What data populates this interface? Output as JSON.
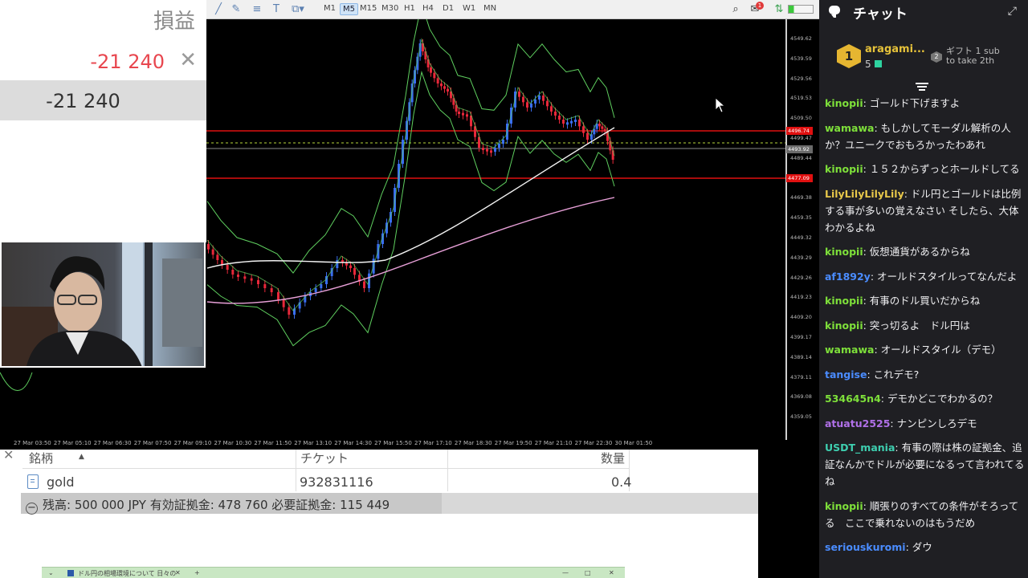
{
  "pl_panel": {
    "title": "損益",
    "profit_value": "-21 240",
    "close_symbol": "✕",
    "total_value": "-21 240"
  },
  "toolbar": {
    "timeframes": [
      "M1",
      "M5",
      "M15",
      "M30",
      "H1",
      "H4",
      "D1",
      "W1",
      "MN"
    ],
    "active_timeframe": "M5",
    "notification_count": "1"
  },
  "chart": {
    "y_labels": [
      "4549.62",
      "4539.59",
      "4529.56",
      "4519.53",
      "4509.50",
      "4499.47",
      "4489.44",
      "4479.41",
      "4469.38",
      "4459.35",
      "4449.32",
      "4439.29",
      "4429.26",
      "4419.23",
      "4409.20",
      "4399.17",
      "4389.14",
      "4379.11",
      "4369.08",
      "4359.05"
    ],
    "price_tags": [
      "4496.74",
      "4493.92",
      "4477.09"
    ],
    "x_labels": [
      "27 Mar 03:50",
      "27 Mar 05:10",
      "27 Mar 06:30",
      "27 Mar 07:50",
      "27 Mar 09:10",
      "27 Mar 10:30",
      "27 Mar 11:50",
      "27 Mar 13:10",
      "27 Mar 14:30",
      "27 Mar 15:50",
      "27 Mar 17:10",
      "27 Mar 18:30",
      "27 Mar 19:50",
      "27 Mar 21:10",
      "27 Mar 22:30",
      "30 Mar 01:50"
    ],
    "colors": {
      "bull": "#3a6ef0",
      "bear": "#e8283a",
      "bollinger": "#5fcf5f",
      "ma_white": "#f2f2f2",
      "ma_pink": "#e8a0d8",
      "level": "#e01010"
    }
  },
  "positions": {
    "close_symbol": "✕",
    "headers": {
      "symbol": "銘柄",
      "ticket": "チケット",
      "volume": "数量"
    },
    "sort_arrow": "▲",
    "row": {
      "symbol": "gold",
      "ticket": "932831116",
      "volume": "0.4"
    },
    "balance_text": "残高: 500 000 JPY  有効証拠金: 478 760  必要証拠金: 115 449",
    "minus_symbol": "−"
  },
  "taskbar": {
    "tab_label": "ドル円の相場環境について 日々の"
  },
  "chat": {
    "title": "チャット",
    "leader": {
      "rank": "1",
      "name": "aragami...",
      "count": "5",
      "rank2": "2",
      "gift_line1": "ギフト 1 sub",
      "gift_line2": "to take 2th"
    },
    "messages": [
      {
        "user": "kinopii",
        "color": "#7ee03a",
        "text": "ゴールド下げますよ"
      },
      {
        "user": "wamawa",
        "color": "#7ee03a",
        "text": "もしかしてモーダル解析の人か？ユニークでおもろかったわあれ"
      },
      {
        "user": "kinopii",
        "color": "#7ee03a",
        "text": "１５２からずっとホールドしてる"
      },
      {
        "user": "LilyLilyLilyLily",
        "color": "#e8c84a",
        "text": "ドル円とゴールドは比例する事が多いの覚えなさい そしたら、大体わかるよね"
      },
      {
        "user": "kinopii",
        "color": "#7ee03a",
        "text": "仮想通貨があるからね"
      },
      {
        "user": "af1892y",
        "color": "#4a8cff",
        "text": "オールドスタイルってなんだよ"
      },
      {
        "user": "kinopii",
        "color": "#7ee03a",
        "text": "有事のドル買いだからね"
      },
      {
        "user": "kinopii",
        "color": "#7ee03a",
        "text": "突っ切るよ　ドル円は"
      },
      {
        "user": "wamawa",
        "color": "#7ee03a",
        "text": "オールドスタイル（デモ）"
      },
      {
        "user": "tangise",
        "color": "#4a8cff",
        "text": "これデモ?"
      },
      {
        "user": "534645n4",
        "color": "#7ee03a",
        "text": "デモかどこでわかるの？"
      },
      {
        "user": "atuatu2525",
        "color": "#b070e8",
        "text": "ナンピンしろデモ"
      },
      {
        "user": "USDT_mania",
        "color": "#3ecfb0",
        "text": "有事の際は株の証拠金、追証なんかでドルが必要になるって言われてるね"
      },
      {
        "user": "kinopii",
        "color": "#7ee03a",
        "text": "順張りのすべての条件がそろってる　ここで乗れないのはもうだめ"
      },
      {
        "user": "seriouskuromi",
        "color": "#4a8cff",
        "text": "ダウ"
      }
    ]
  }
}
